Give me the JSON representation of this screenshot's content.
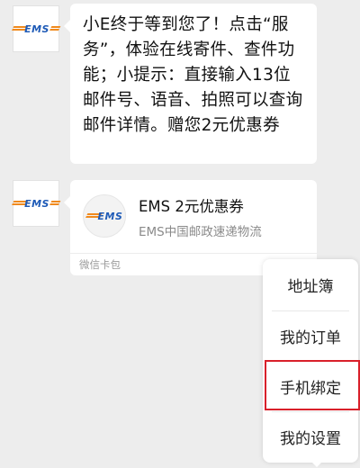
{
  "chat": {
    "sender_logo_text": "EMS",
    "message_text": "小E终于等到您了！点击“服务”，体验在线寄件、查件功能；小提示：直接输入13位邮件号、语音、拍照可以查询邮件详情。赠您2元优惠券",
    "card": {
      "logo_text": "EMS",
      "title": "EMS 2元优惠券",
      "subtitle": "EMS中国邮政速递物流",
      "footer": "微信卡包"
    }
  },
  "menu": {
    "items": [
      {
        "label": "地址簿"
      },
      {
        "label": "我的订单"
      },
      {
        "label": "手机绑定"
      },
      {
        "label": "我的设置"
      }
    ],
    "highlighted_index": 2
  },
  "colors": {
    "ems_blue": "#1f5bb7",
    "ems_orange": "#f08a1d",
    "highlight_red": "#d9202a",
    "background": "#ededed"
  }
}
